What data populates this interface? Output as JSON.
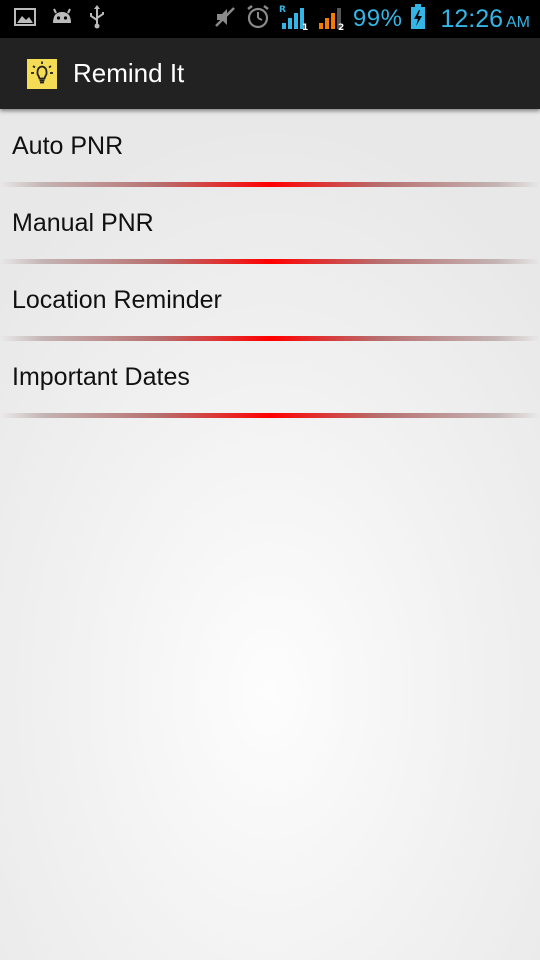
{
  "status_bar": {
    "battery": "99%",
    "time": "12:26",
    "ampm": "AM",
    "icons": [
      "image-icon",
      "android-icon",
      "usb-icon",
      "mute-icon",
      "alarm-icon",
      "signal-sim1-icon",
      "signal-sim2-icon",
      "battery-charging-icon"
    ],
    "accent_color": "#33b5e5"
  },
  "action_bar": {
    "title": "Remind It",
    "icon": "lightbulb-icon"
  },
  "list": {
    "items": [
      {
        "label": "Auto PNR"
      },
      {
        "label": "Manual PNR"
      },
      {
        "label": "Location Reminder"
      },
      {
        "label": "Important Dates"
      }
    ],
    "divider_color": "#ff0000"
  }
}
